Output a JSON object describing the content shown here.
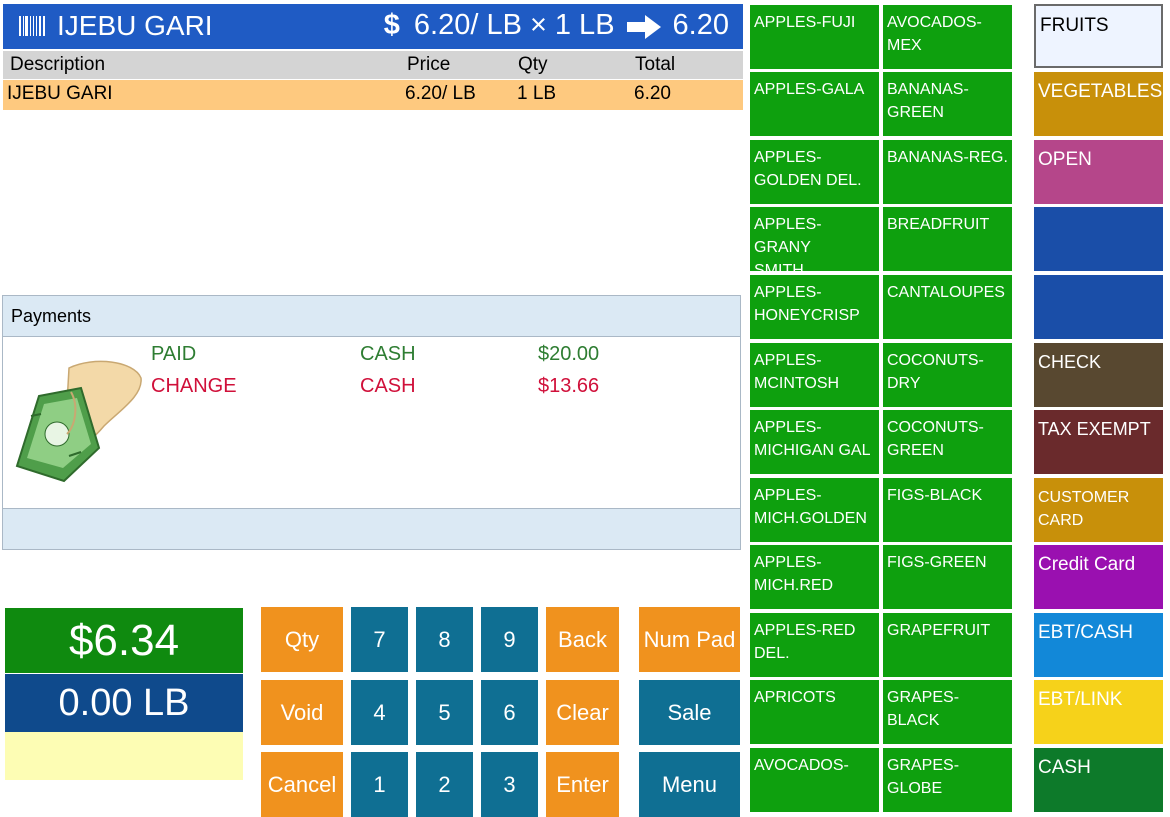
{
  "item_bar": {
    "name": "IJEBU GARI",
    "dollar_sign": "$",
    "unit_price": "6.20/ LB",
    "times": "×",
    "qty": "1  LB",
    "extended": "6.20"
  },
  "table": {
    "headers": {
      "description": "Description",
      "price": "Price",
      "qty": "Qty",
      "total": "Total"
    },
    "rows": [
      {
        "description": "IJEBU GARI",
        "price": "6.20/ LB",
        "qty": "1  LB",
        "total": "6.20"
      }
    ]
  },
  "payments": {
    "title": "Payments",
    "lines": [
      {
        "type": "PAID",
        "method": "CASH",
        "amount": "$20.00"
      },
      {
        "type": "CHANGE",
        "method": "CASH",
        "amount": "$13.66"
      }
    ]
  },
  "totals": {
    "amount": "$6.34",
    "weight": "0.00 LB"
  },
  "keypad": {
    "qty": "Qty",
    "void": "Void",
    "cancel": "Cancel",
    "digits": [
      "7",
      "8",
      "9",
      "4",
      "5",
      "6",
      "1",
      "2",
      "3"
    ],
    "back": "Back",
    "clear": "Clear",
    "enter": "Enter",
    "num_pad": "Num Pad",
    "sale": "Sale",
    "menu": "Menu"
  },
  "products_col1": [
    "APPLES-FUJI",
    "APPLES-GALA",
    "APPLES-\nGOLDEN DEL.",
    "APPLES-GRANY\nSMITH",
    "APPLES-\nHONEYCRISP",
    "APPLES-\nMCINTOSH",
    "APPLES-\nMICHIGAN GAL",
    "APPLES-\nMICH.GOLDEN",
    "APPLES-\nMICH.RED",
    "APPLES-RED\nDEL.",
    "APRICOTS",
    "AVOCADOS-"
  ],
  "products_col2": [
    "AVOCADOS-\nMEX",
    "BANANAS-\nGREEN",
    "BANANAS-REG.",
    "BREADFRUIT",
    "CANTALOUPES",
    "COCONUTS-\nDRY",
    "COCONUTS-\nGREEN",
    "FIGS-BLACK",
    "FIGS-GREEN",
    "GRAPEFRUIT",
    "GRAPES-BLACK",
    "GRAPES-GLOBE"
  ],
  "categories": {
    "fruits": "FRUITS",
    "vegetables": "VEGETABLES",
    "open": "OPEN",
    "check": "CHECK",
    "tax_exempt": "TAX EXEMPT",
    "customer_card": "CUSTOMER\nCARD",
    "credit_card": "Credit Card",
    "ebt_cash": "EBT/CASH",
    "ebt_link": "EBT/LINK",
    "cash": "CASH"
  },
  "colors": {
    "item_bar": "#1f5bc4",
    "product": "#0ea00e",
    "orange_key": "#f0921e",
    "teal_key": "#0f6f93"
  }
}
